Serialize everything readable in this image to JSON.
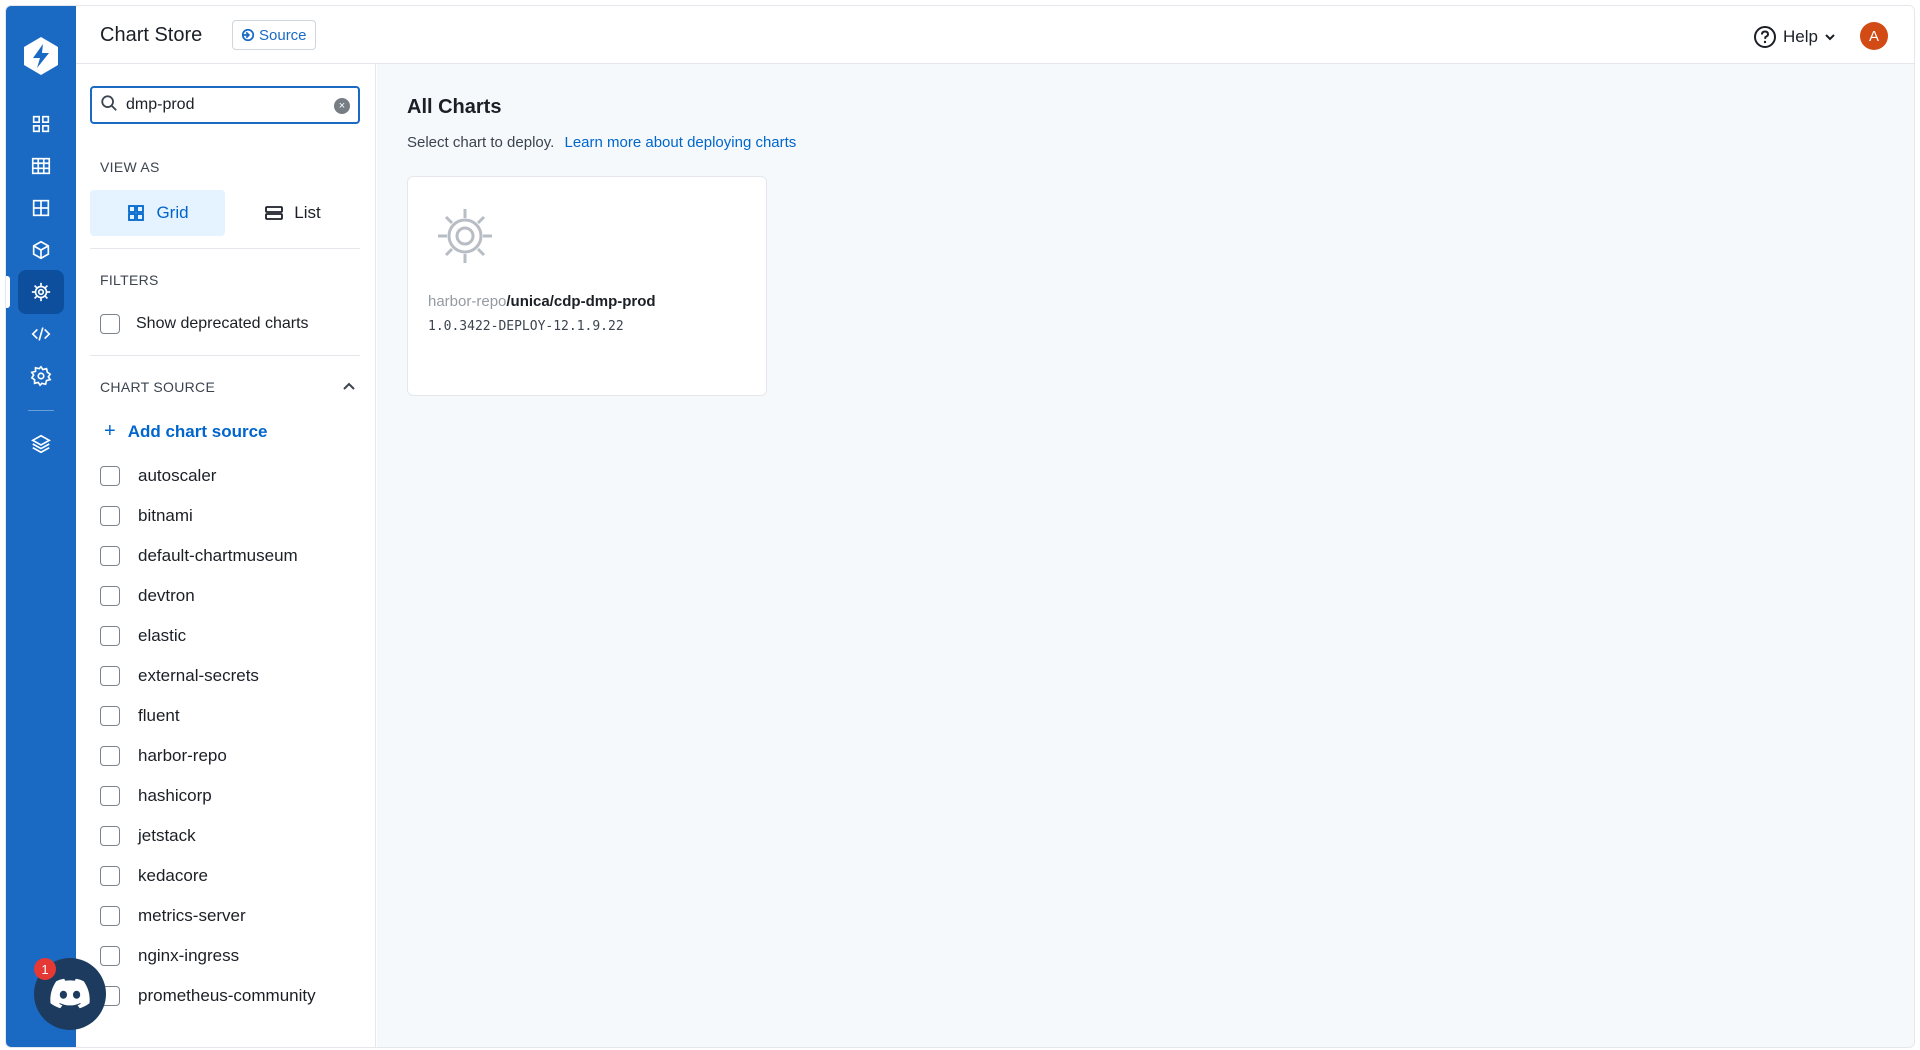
{
  "header": {
    "title": "Chart Store",
    "source_label": "Source",
    "help_label": "Help",
    "avatar_initial": "A"
  },
  "nav": {
    "items": [
      {
        "icon": "apps-grid-icon"
      },
      {
        "icon": "table-grid-icon"
      },
      {
        "icon": "dashboard-grid-icon"
      },
      {
        "icon": "cube-icon"
      },
      {
        "icon": "helm-wheel-icon",
        "active": true
      },
      {
        "icon": "code-icon"
      },
      {
        "icon": "gear-icon"
      },
      {
        "icon": "stack-layers-icon"
      }
    ]
  },
  "sidebar": {
    "search": {
      "value": "dmp-prod",
      "placeholder": "Search charts"
    },
    "view_as_label": "VIEW AS",
    "view_options": [
      {
        "label": "Grid",
        "active": true
      },
      {
        "label": "List",
        "active": false
      }
    ],
    "filters_label": "FILTERS",
    "show_deprecated_label": "Show deprecated charts",
    "chart_source_label": "CHART SOURCE",
    "add_chart_source_label": "Add chart source",
    "sources": [
      "autoscaler",
      "bitnami",
      "default-chartmuseum",
      "devtron",
      "elastic",
      "external-secrets",
      "fluent",
      "harbor-repo",
      "hashicorp",
      "jetstack",
      "kedacore",
      "metrics-server",
      "nginx-ingress",
      "prometheus-community"
    ]
  },
  "main": {
    "heading": "All Charts",
    "subtitle": "Select chart to deploy.",
    "learn_more_label": "Learn more about deploying charts",
    "charts": [
      {
        "repo": "harbor-repo",
        "path": "/unica/cdp-dmp-prod",
        "version": "1.0.3422-DEPLOY-12.1.9.22"
      }
    ]
  },
  "discord": {
    "badge_count": "1"
  },
  "colors": {
    "rail": "#1a6ac4",
    "accent": "#0066cc",
    "avatar": "#d24a14",
    "badge": "#e53935"
  }
}
